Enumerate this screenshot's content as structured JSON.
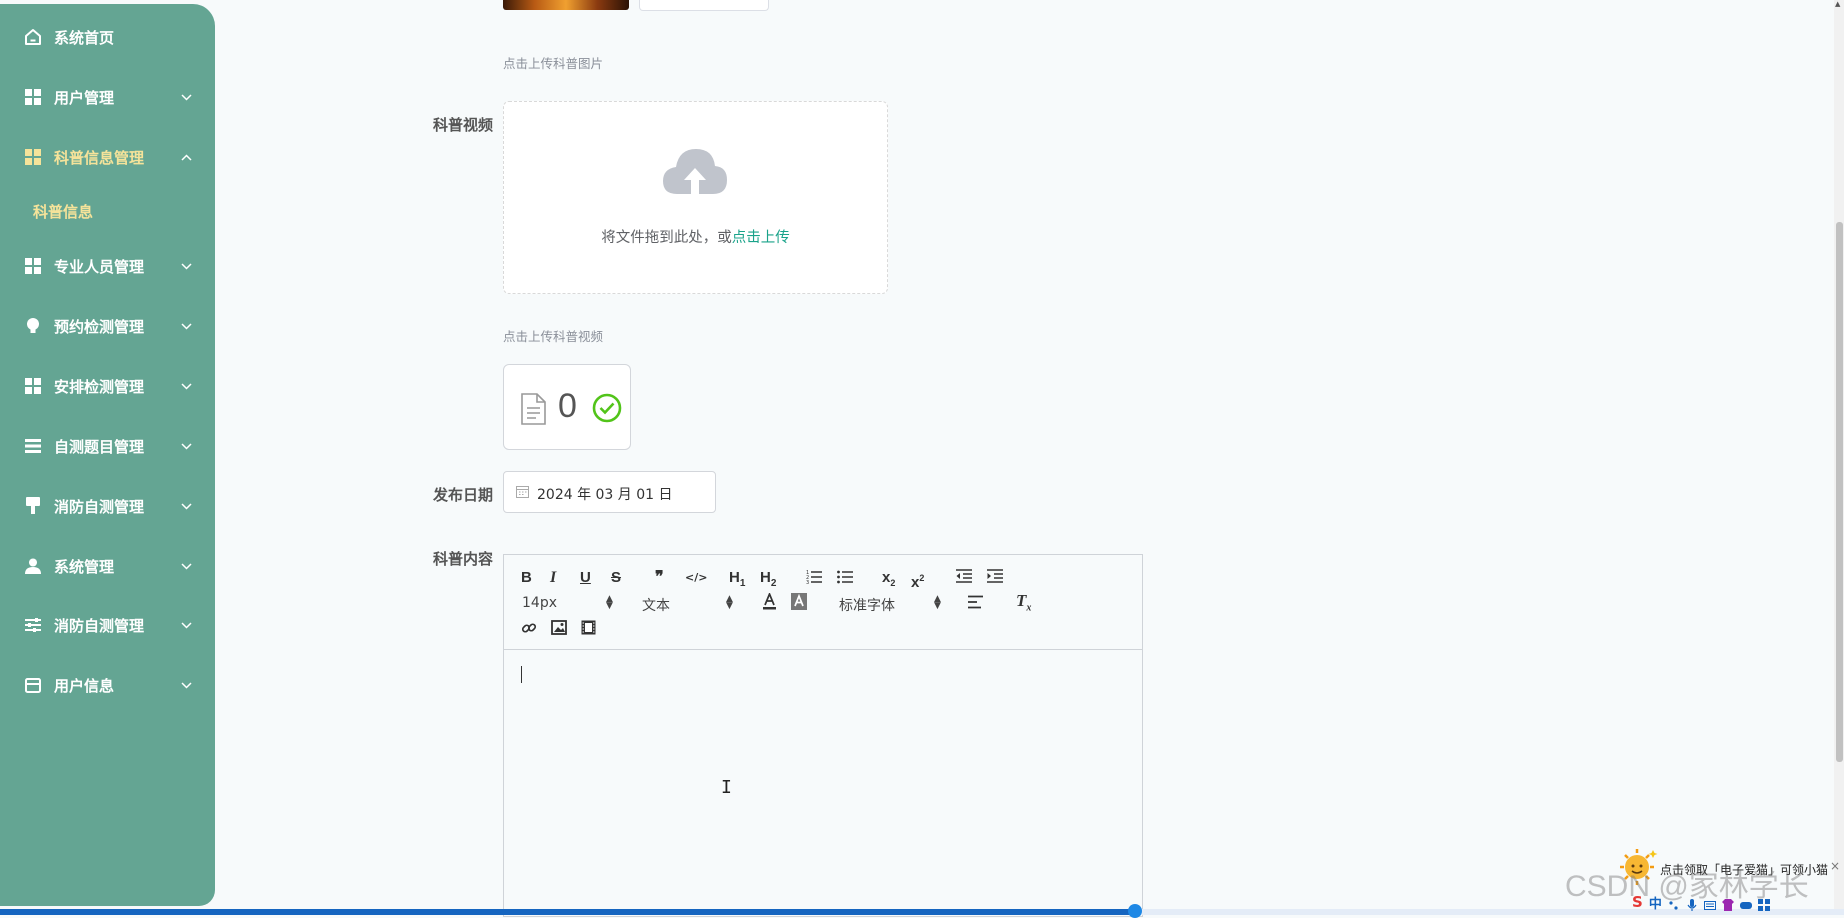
{
  "sidebar": {
    "items": [
      {
        "label": "系统首页",
        "icon": "home-icon"
      },
      {
        "label": "用户管理",
        "icon": "grid-icon"
      },
      {
        "label": "科普信息管理",
        "icon": "grid-icon"
      },
      {
        "label": "专业人员管理",
        "icon": "grid-icon"
      },
      {
        "label": "预约检测管理",
        "icon": "bulb-icon"
      },
      {
        "label": "安排检测管理",
        "icon": "grid-icon"
      },
      {
        "label": "自测题目管理",
        "icon": "list-icon"
      },
      {
        "label": "消防自测管理",
        "icon": "brush-icon"
      },
      {
        "label": "系统管理",
        "icon": "user-icon"
      },
      {
        "label": "消防自测管理",
        "icon": "sliders-icon"
      },
      {
        "label": "用户信息",
        "icon": "card-icon"
      }
    ],
    "sub_items": [
      {
        "label": "科普信息"
      }
    ]
  },
  "form": {
    "image_hint": "点击上传科普图片",
    "video_label": "科普视频",
    "upload_text": "将文件拖到此处，或",
    "upload_link": "点击上传",
    "video_hint": "点击上传科普视频",
    "file_count": "0",
    "date_label": "发布日期",
    "date_value": "2024 年 03 月 01 日",
    "content_label": "科普内容"
  },
  "editor": {
    "toolbar": {
      "bold": "B",
      "italic": "I",
      "underline": "U",
      "strike": "S",
      "quote": "❞",
      "code": "</>",
      "h1": "H",
      "h1_sub": "1",
      "h2": "H",
      "h2_sub": "2",
      "sub": "x",
      "sub_sub": "2",
      "sup": "x",
      "sup_sup": "2",
      "font_size": "14px",
      "block": "文本",
      "font_family": "标准字体",
      "clear": "T",
      "clear_sub": "x"
    }
  },
  "overlay": {
    "notice": "点击领取「电子爱猫」可领小猫",
    "notice_close": "×",
    "watermark": "CSDN @家林学长",
    "tray_logo": "S",
    "tray_lang": "中"
  },
  "colors": {
    "sidebar_bg": "#64a593",
    "active_text": "#f5e39a",
    "link": "#1aa38a",
    "success": "#52c41a"
  }
}
